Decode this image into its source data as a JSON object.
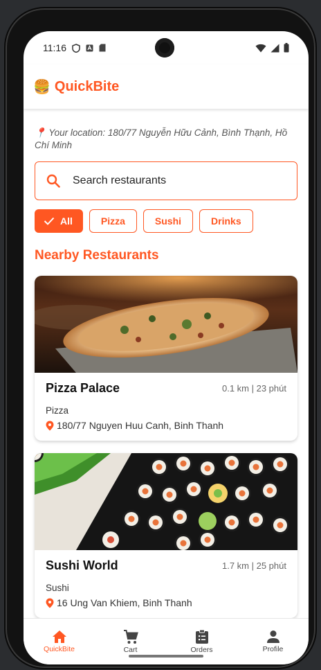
{
  "status": {
    "time": "11:16"
  },
  "app": {
    "title": "QuickBite",
    "logo_emoji": "🍔"
  },
  "location": {
    "pin": "📍",
    "text": "Your location: 180/77 Nguyễn Hữu Cảnh, Bình Thạnh, Hồ Chí Minh"
  },
  "search": {
    "placeholder": "Search restaurants"
  },
  "filters": [
    {
      "label": "All",
      "selected": true
    },
    {
      "label": "Pizza",
      "selected": false
    },
    {
      "label": "Sushi",
      "selected": false
    },
    {
      "label": "Drinks",
      "selected": false
    }
  ],
  "section": {
    "title": "Nearby Restaurants"
  },
  "restaurants": [
    {
      "name": "Pizza Palace",
      "meta": "0.1 km | 23 phút",
      "category": "Pizza",
      "address": "180/77 Nguyen Huu Canh, Binh Thanh"
    },
    {
      "name": "Sushi World",
      "meta": "1.7 km | 25 phút",
      "category": "Sushi",
      "address": "16 Ung Van Khiem, Binh Thanh"
    }
  ],
  "nav": [
    {
      "label": "QuickBite",
      "icon": "home-icon",
      "active": true
    },
    {
      "label": "Cart",
      "icon": "cart-icon",
      "active": false
    },
    {
      "label": "Orders",
      "icon": "orders-icon",
      "active": false
    },
    {
      "label": "Profile",
      "icon": "profile-icon",
      "active": false
    }
  ],
  "colors": {
    "accent": "#ff5722"
  }
}
